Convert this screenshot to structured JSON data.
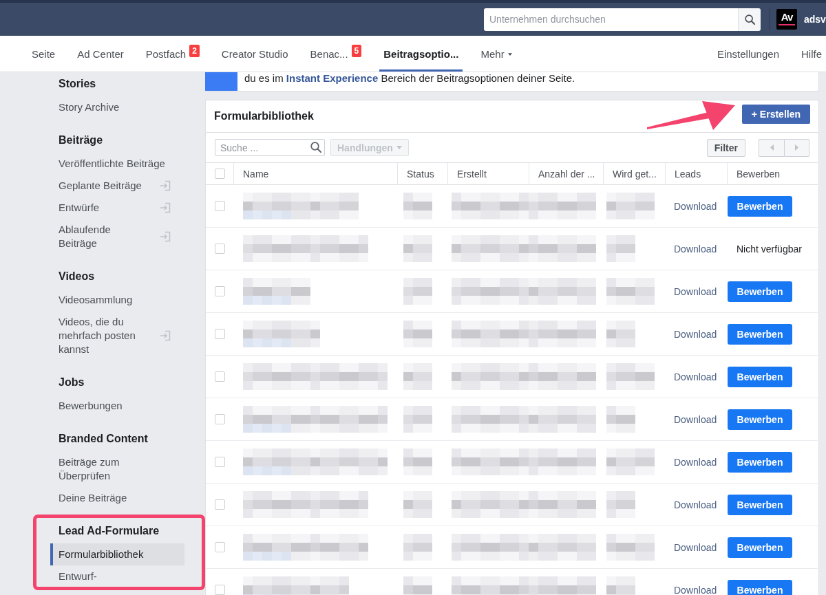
{
  "top_bar": {
    "search": {
      "placeholder": "Unternehmen durchsuchen"
    },
    "account": {
      "logo": "Av",
      "name": "adsv"
    }
  },
  "tabs": [
    {
      "label": "Seite",
      "selected": false,
      "dropdown": false
    },
    {
      "label": "Ad Center",
      "selected": false,
      "dropdown": false
    },
    {
      "label": "Postfach",
      "badge": "2",
      "selected": false,
      "dropdown": false
    },
    {
      "label": "Creator Studio",
      "selected": false,
      "dropdown": false
    },
    {
      "label": "Benac...",
      "badge": "5",
      "selected": false,
      "dropdown": false
    },
    {
      "label": "Beitragsoptio...",
      "selected": true,
      "dropdown": false
    },
    {
      "label": "Mehr",
      "selected": false,
      "dropdown": true
    }
  ],
  "nav_links": [
    "Einstellungen",
    "Hilfe"
  ],
  "sidebar": {
    "sections": [
      {
        "title": "Stories",
        "annotated": false,
        "items": [
          {
            "label": "Story Archive",
            "external": false,
            "selected": false
          }
        ]
      },
      {
        "title": "Beiträge",
        "annotated": false,
        "items": [
          {
            "label": "Veröffentlichte Beiträge",
            "external": false,
            "selected": false
          },
          {
            "label": "Geplante Beiträge",
            "external": true,
            "selected": false
          },
          {
            "label": "Entwürfe",
            "external": true,
            "selected": false
          },
          {
            "label": "Ablaufende Beiträge",
            "external": true,
            "selected": false
          }
        ]
      },
      {
        "title": "Videos",
        "annotated": false,
        "items": [
          {
            "label": "Videosammlung",
            "external": false,
            "selected": false
          },
          {
            "label": "Videos, die du mehrfach posten kannst",
            "external": true,
            "selected": false
          }
        ]
      },
      {
        "title": "Jobs",
        "annotated": false,
        "items": [
          {
            "label": "Bewerbungen",
            "external": false,
            "selected": false
          }
        ]
      },
      {
        "title": "Branded Content",
        "annotated": false,
        "items": [
          {
            "label": "Beiträge zum Überprüfen",
            "external": false,
            "selected": false
          },
          {
            "label": "Deine Beiträge",
            "external": false,
            "selected": false
          }
        ]
      },
      {
        "title": "Lead Ad-Formulare",
        "annotated": true,
        "items": [
          {
            "label": "Formularbibliothek",
            "external": false,
            "selected": true
          },
          {
            "label": "Entwurf-",
            "external": false,
            "selected": false
          }
        ]
      }
    ]
  },
  "notice": {
    "parts": [
      {
        "kind": "text",
        "text": "du es im "
      },
      {
        "kind": "link",
        "text": "Instant Experience"
      },
      {
        "kind": "text",
        "text": " Bereich der Beitragsoptionen deiner Seite."
      }
    ]
  },
  "card": {
    "title": "Formularbibliothek",
    "create_button": {
      "label": "+ Erstellen",
      "annotated": true
    },
    "toolbar": {
      "search": {
        "placeholder": "Suche ..."
      },
      "actions": {
        "label": "Handlungen",
        "disabled": true
      },
      "filter": "Filter",
      "pager": [
        {
          "kind": "prev",
          "disabled": true
        },
        {
          "kind": "next",
          "disabled": true
        }
      ]
    },
    "table": {
      "select_all": {
        "checked": false
      },
      "columns": [
        "Name",
        "Status",
        "Erstellt",
        "Anzahl der ...",
        "Wird get...",
        "Leads",
        "Bewerben"
      ],
      "rows": [
        {
          "checked": false,
          "leads": "Download",
          "apply": {
            "kind": "button",
            "label": "Bewerben"
          }
        },
        {
          "checked": false,
          "leads": "Download",
          "apply": {
            "kind": "text",
            "label": "Nicht verfügbar"
          }
        },
        {
          "checked": false,
          "leads": "Download",
          "apply": {
            "kind": "button",
            "label": "Bewerben"
          }
        },
        {
          "checked": false,
          "leads": "Download",
          "apply": {
            "kind": "button",
            "label": "Bewerben"
          }
        },
        {
          "checked": false,
          "leads": "Download",
          "apply": {
            "kind": "button",
            "label": "Bewerben"
          }
        },
        {
          "checked": false,
          "leads": "Download",
          "apply": {
            "kind": "button",
            "label": "Bewerben"
          }
        },
        {
          "checked": false,
          "leads": "Download",
          "apply": {
            "kind": "button",
            "label": "Bewerben"
          }
        },
        {
          "checked": false,
          "leads": "Download",
          "apply": {
            "kind": "button",
            "label": "Bewerben"
          }
        },
        {
          "checked": false,
          "leads": "Download",
          "apply": {
            "kind": "button",
            "label": "Bewerben"
          }
        },
        {
          "checked": false,
          "leads": "Download",
          "apply": {
            "kind": "button",
            "label": "Bewerben"
          }
        }
      ]
    }
  }
}
